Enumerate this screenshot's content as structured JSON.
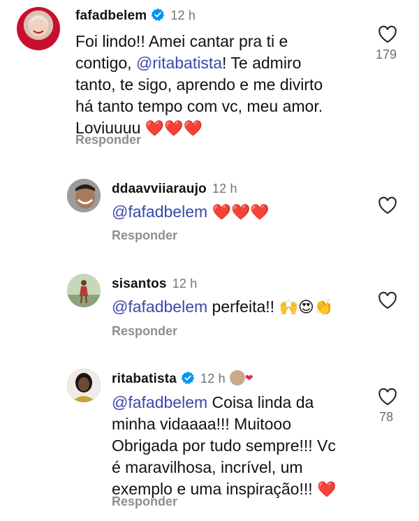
{
  "comments": [
    {
      "username": "fafadbelem",
      "verified": true,
      "time": "12 h",
      "text_before": "Foi lindo!! Amei cantar pra ti e\ncontigo, ",
      "mention": "@ritabatista",
      "text_after": "! Te admiro\ntanto, te sigo, aprendo e me divirto\nhá tanto tempo com vc, meu amor.\nLoviuuuu ",
      "emojis": "❤️❤️❤️",
      "reply_label": "Responder",
      "like_count": "179",
      "avatar_icon": "avatar-photo"
    },
    {
      "username": "ddaavviiaraujo",
      "verified": false,
      "time": "12 h",
      "mention": "@fafadbelem",
      "text_after": " ",
      "emojis": "❤️❤️❤️",
      "reply_label": "Responder",
      "avatar_icon": "avatar-photo"
    },
    {
      "username": "sisantos",
      "verified": false,
      "time": "12 h",
      "mention": "@fafadbelem",
      "text_after": " perfeita!! ",
      "emojis": "🙌😍👏",
      "reply_label": "Responder",
      "avatar_icon": "avatar-photo"
    },
    {
      "username": "ritabatista",
      "verified": true,
      "time": "12 h",
      "mention": "@fafadbelem",
      "text_after": " Coisa linda da\nminha vidaaaa!!! Muitooo\nObrigada por tudo sempre!!! Vc\né maravilhosa, incrível, um\nexemplo e uma inspiração!!! ",
      "emojis": "❤️",
      "reply_label": "Responder",
      "like_count": "78",
      "avatar_icon": "avatar-photo"
    }
  ],
  "colors": {
    "mention": "#3949ab",
    "verified": "#0095f6",
    "secondary_text": "#737373"
  },
  "icons": {
    "like": "heart-outline-icon",
    "verified": "verified-badge-icon"
  }
}
